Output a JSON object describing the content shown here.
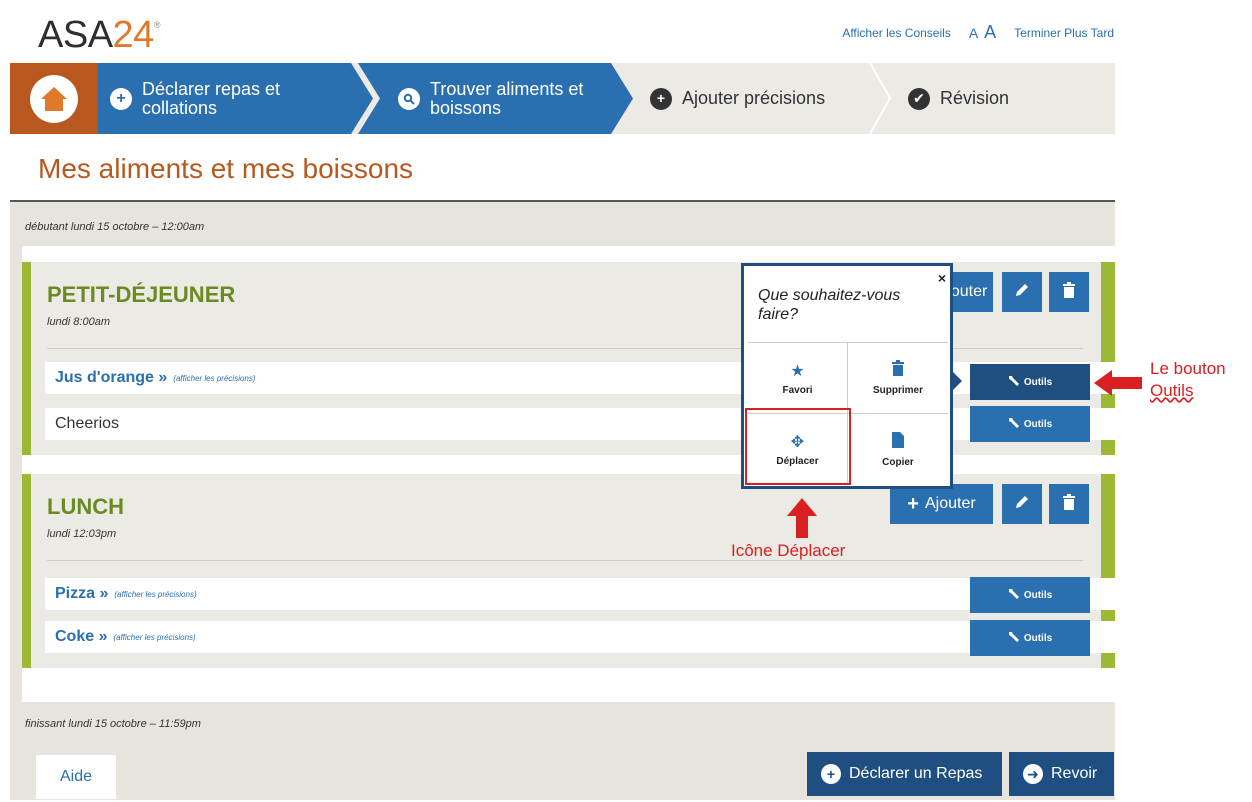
{
  "header": {
    "logo_text": "ASA",
    "logo_num": "24",
    "logo_mark": "®",
    "links": {
      "tips": "Afficher les Conseils",
      "font_small": "A",
      "font_large": "A",
      "finish_later": "Terminer Plus Tard"
    }
  },
  "steps": [
    {
      "label": "Déclarer repas et collations",
      "icon": "plus-circle-icon"
    },
    {
      "label": "Trouver aliments et boissons",
      "icon": "search-icon"
    },
    {
      "label": "Ajouter précisions",
      "icon": "plus-circle-icon"
    },
    {
      "label": "Révision",
      "icon": "check-circle-icon"
    }
  ],
  "page_title": "Mes aliments et mes boissons",
  "timeline": {
    "start": "débutant lundi 15 octobre – 12:00am",
    "end": "finissant lundi 15 octobre – 11:59pm"
  },
  "meals": [
    {
      "title": "PETIT-DÉJEUNER",
      "time": "lundi 8:00am",
      "add_label": "Ajouter",
      "items": [
        {
          "name": "Jus d'orange »",
          "details": "(afficher les précisions)",
          "tools": "Outils"
        },
        {
          "name": "Cheerios",
          "details": "",
          "tools": "Outils"
        }
      ]
    },
    {
      "title": "LUNCH",
      "time": "lundi 12:03pm",
      "add_label": "Ajouter",
      "items": [
        {
          "name": "Pizza »",
          "details": "(afficher les précisions)",
          "tools": "Outils"
        },
        {
          "name": "Coke »",
          "details": "(afficher les précisions)",
          "tools": "Outils"
        }
      ]
    }
  ],
  "popup": {
    "question": "Que souhaitez-vous faire?",
    "close": "×",
    "options": [
      {
        "label": "Favori",
        "icon": "star-icon"
      },
      {
        "label": "Supprimer",
        "icon": "trash-icon"
      },
      {
        "label": "Déplacer",
        "icon": "move-icon"
      },
      {
        "label": "Copier",
        "icon": "copy-icon"
      }
    ]
  },
  "annotations": {
    "tools_button_line1": "Le bouton",
    "tools_button_line2": "Outils",
    "move_icon": "Icône Déplacer"
  },
  "bottom": {
    "help": "Aide",
    "declare_meal": "Déclarer un Repas",
    "review": "Revoir"
  },
  "colors": {
    "primary_blue": "#2a6fb0",
    "dark_blue": "#1e4f80",
    "brand_orange": "#b8581e",
    "meal_green": "#9cb834",
    "annotation_red": "#d92020"
  }
}
